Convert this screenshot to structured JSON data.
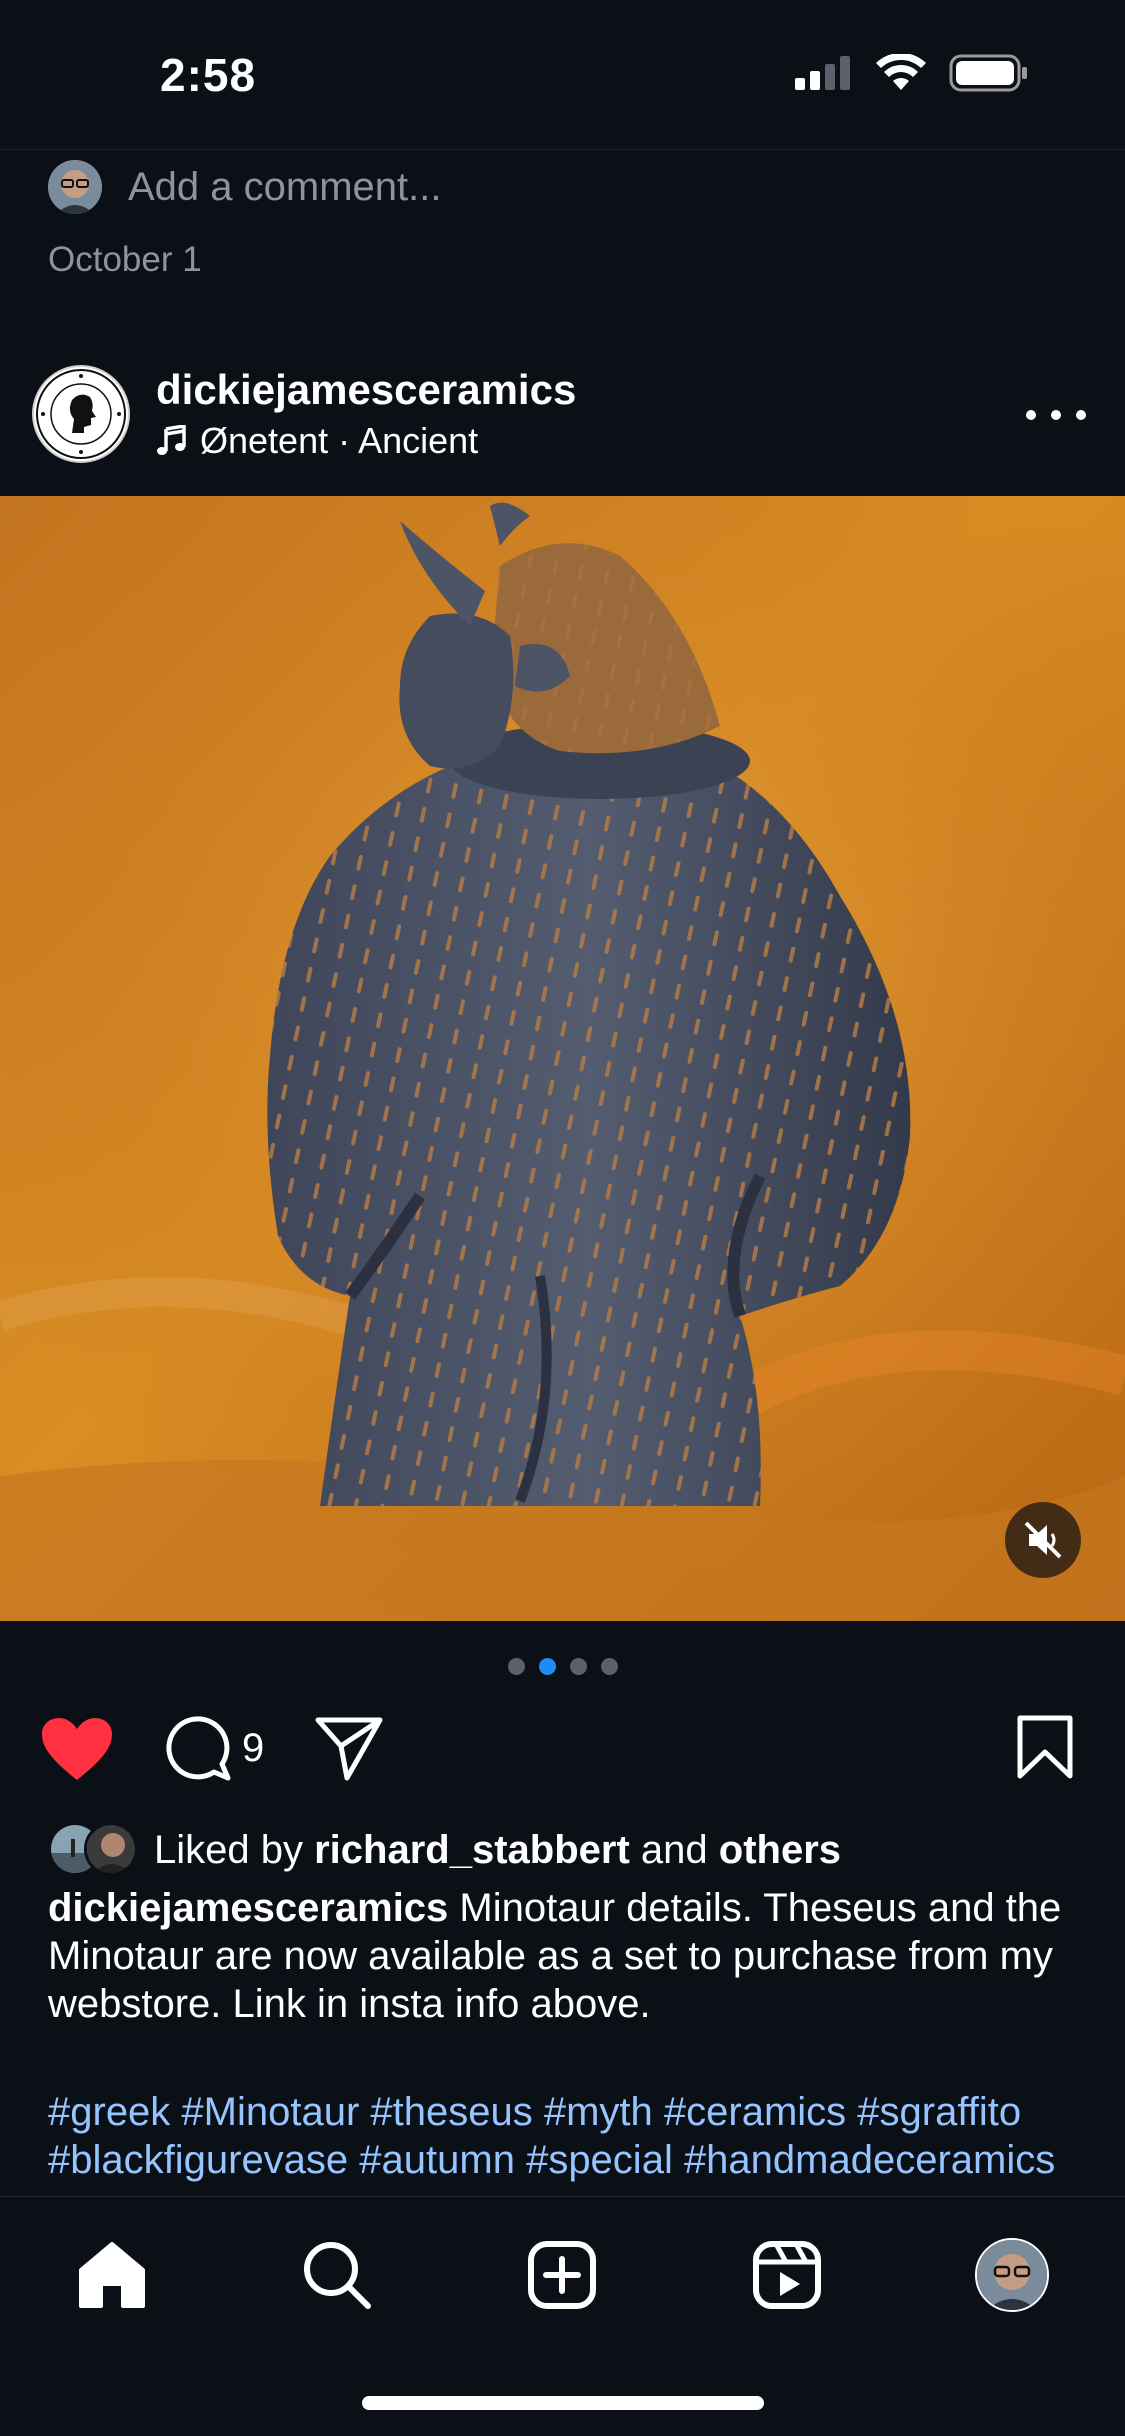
{
  "status_bar": {
    "time": "2:58"
  },
  "comment_box": {
    "placeholder": "Add a comment..."
  },
  "previous_post": {
    "date": "October 1"
  },
  "post": {
    "username": "dickiejamesceramics",
    "audio": "Ønetent · Ancient",
    "comment_count": "9",
    "carousel": {
      "total": 4,
      "active_index": 1
    },
    "liked_by": {
      "prefix": "Liked by",
      "user": "richard_stabbert",
      "joiner": "and",
      "others": "others"
    },
    "caption": {
      "username": "dickiejamesceramics",
      "text": "Minotaur details. Theseus and the Minotaur are now available as a set to purchase from my webstore. Link in insta info above."
    },
    "hashtags": "#greek #Minotaur #theseus #myth #ceramics #sgraffito #blackfigurevase #autumn #special #handmadeceramics"
  },
  "colors": {
    "background": "#0b0f16",
    "like_red": "#ff3040",
    "link_blue": "#96c4ff",
    "dot_active": "#1d8cf5"
  },
  "icons": {
    "like": "heart-filled-icon",
    "comment": "comment-bubble-icon",
    "share": "paper-plane-icon",
    "save": "bookmark-icon",
    "home": "home-icon",
    "search": "search-icon",
    "create": "plus-square-icon",
    "reels": "reels-icon",
    "mute": "speaker-muted-icon"
  }
}
